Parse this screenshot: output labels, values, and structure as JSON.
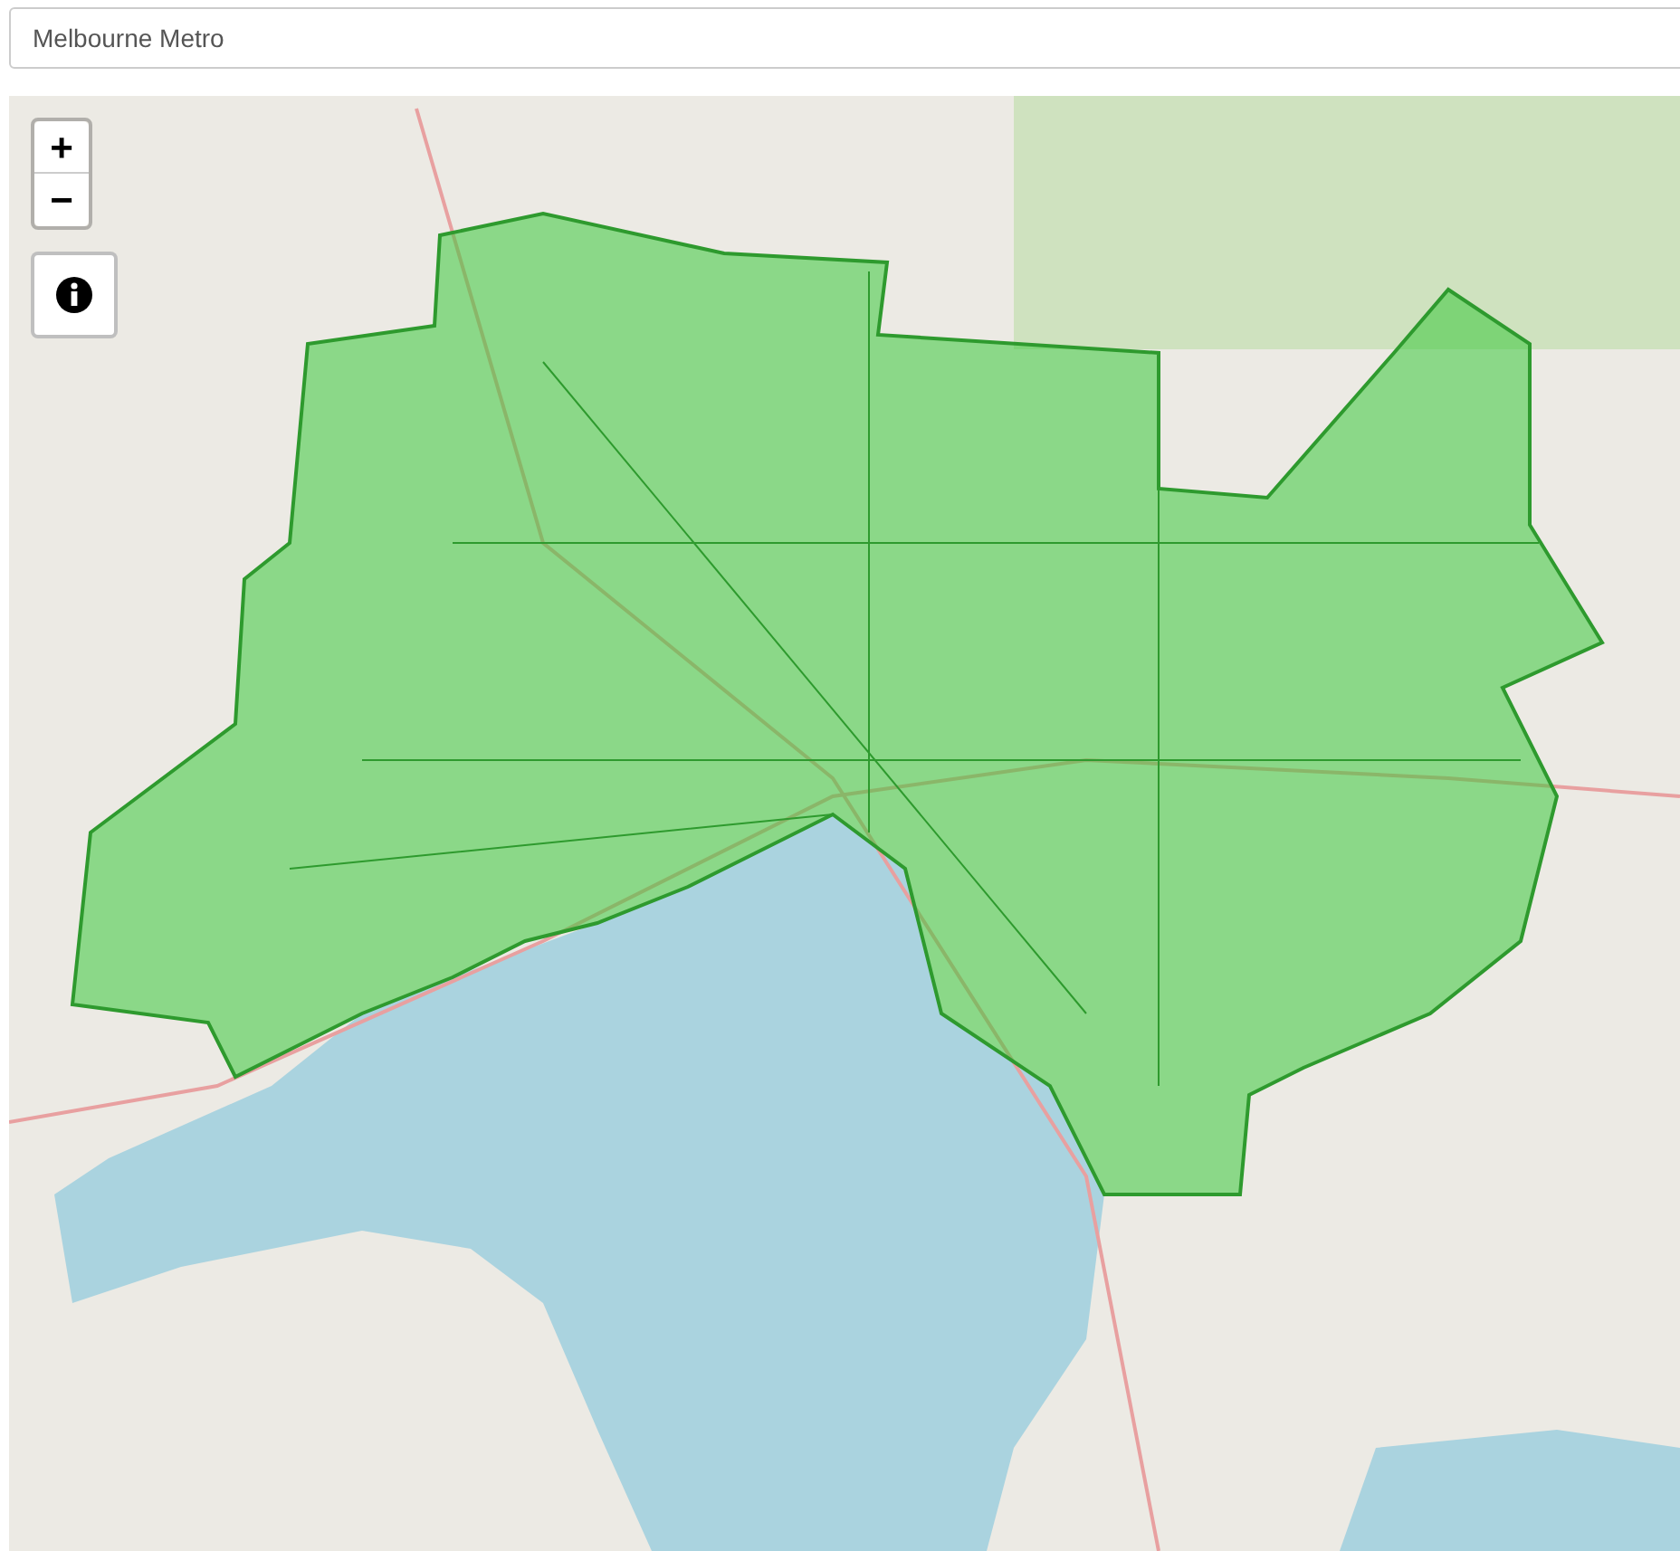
{
  "search": {
    "value": "Melbourne Metro"
  },
  "zoom_controls": [
    {
      "label": "+",
      "kind": "in"
    },
    {
      "label": "−",
      "kind": "out"
    }
  ]
}
